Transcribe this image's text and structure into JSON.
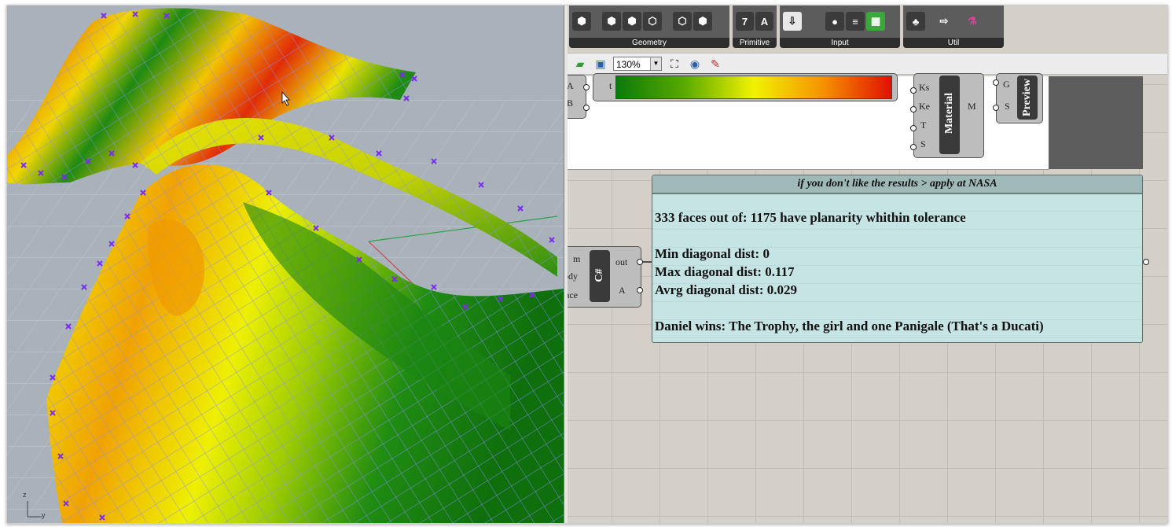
{
  "viewport": {
    "axis_z": "z",
    "axis_y": "y"
  },
  "ribbon": {
    "groups": [
      {
        "label": "Geometry",
        "icons": [
          "hexagon-icon",
          "hexagon-dot-icon",
          "hexagon-link-icon",
          "hexagon-diamond-icon",
          "hexagon-circle-icon",
          "hexagon-solid-icon"
        ]
      },
      {
        "label": "Primitive",
        "icons": [
          "seven-icon",
          "letter-a-icon"
        ]
      },
      {
        "label": "Input",
        "icons": [
          "import-icon",
          "button-icon",
          "list-icon",
          "checker-icon"
        ]
      },
      {
        "label": "Util",
        "icons": [
          "tree-icon",
          "arrow-icon",
          "flask-icon"
        ]
      }
    ]
  },
  "toolbar": {
    "zoom": "130%"
  },
  "components": {
    "merge_inputs": [
      "A",
      "B"
    ],
    "gradient_input": "t",
    "material_label": "Material",
    "material_inputs": [
      "Ks",
      "Ke",
      "T",
      "S"
    ],
    "material_output": "M",
    "preview_label": "Preview",
    "preview_inputs": [
      "G",
      "S"
    ],
    "script_label": "C#",
    "script_inputs": [
      "m",
      "body",
      "ance"
    ],
    "script_outputs": [
      "out",
      "A"
    ]
  },
  "panel": {
    "title": "if you don't like the results > apply at NASA",
    "lines": [
      "333 faces out of: 1175 have planarity whithin tolerance",
      "Min diagonal dist: 0",
      "Max diagonal dist: 0.117",
      "Avrg diagonal dist: 0.029",
      "Daniel wins: The Trophy, the girl and one Panigale (That's a Ducati)"
    ]
  },
  "colors": {
    "gradient": [
      "#0b7a0b",
      "#f2f200",
      "#e11000"
    ],
    "panel_bg": "#c5e4e3",
    "control_point": "#7a2cf0"
  }
}
